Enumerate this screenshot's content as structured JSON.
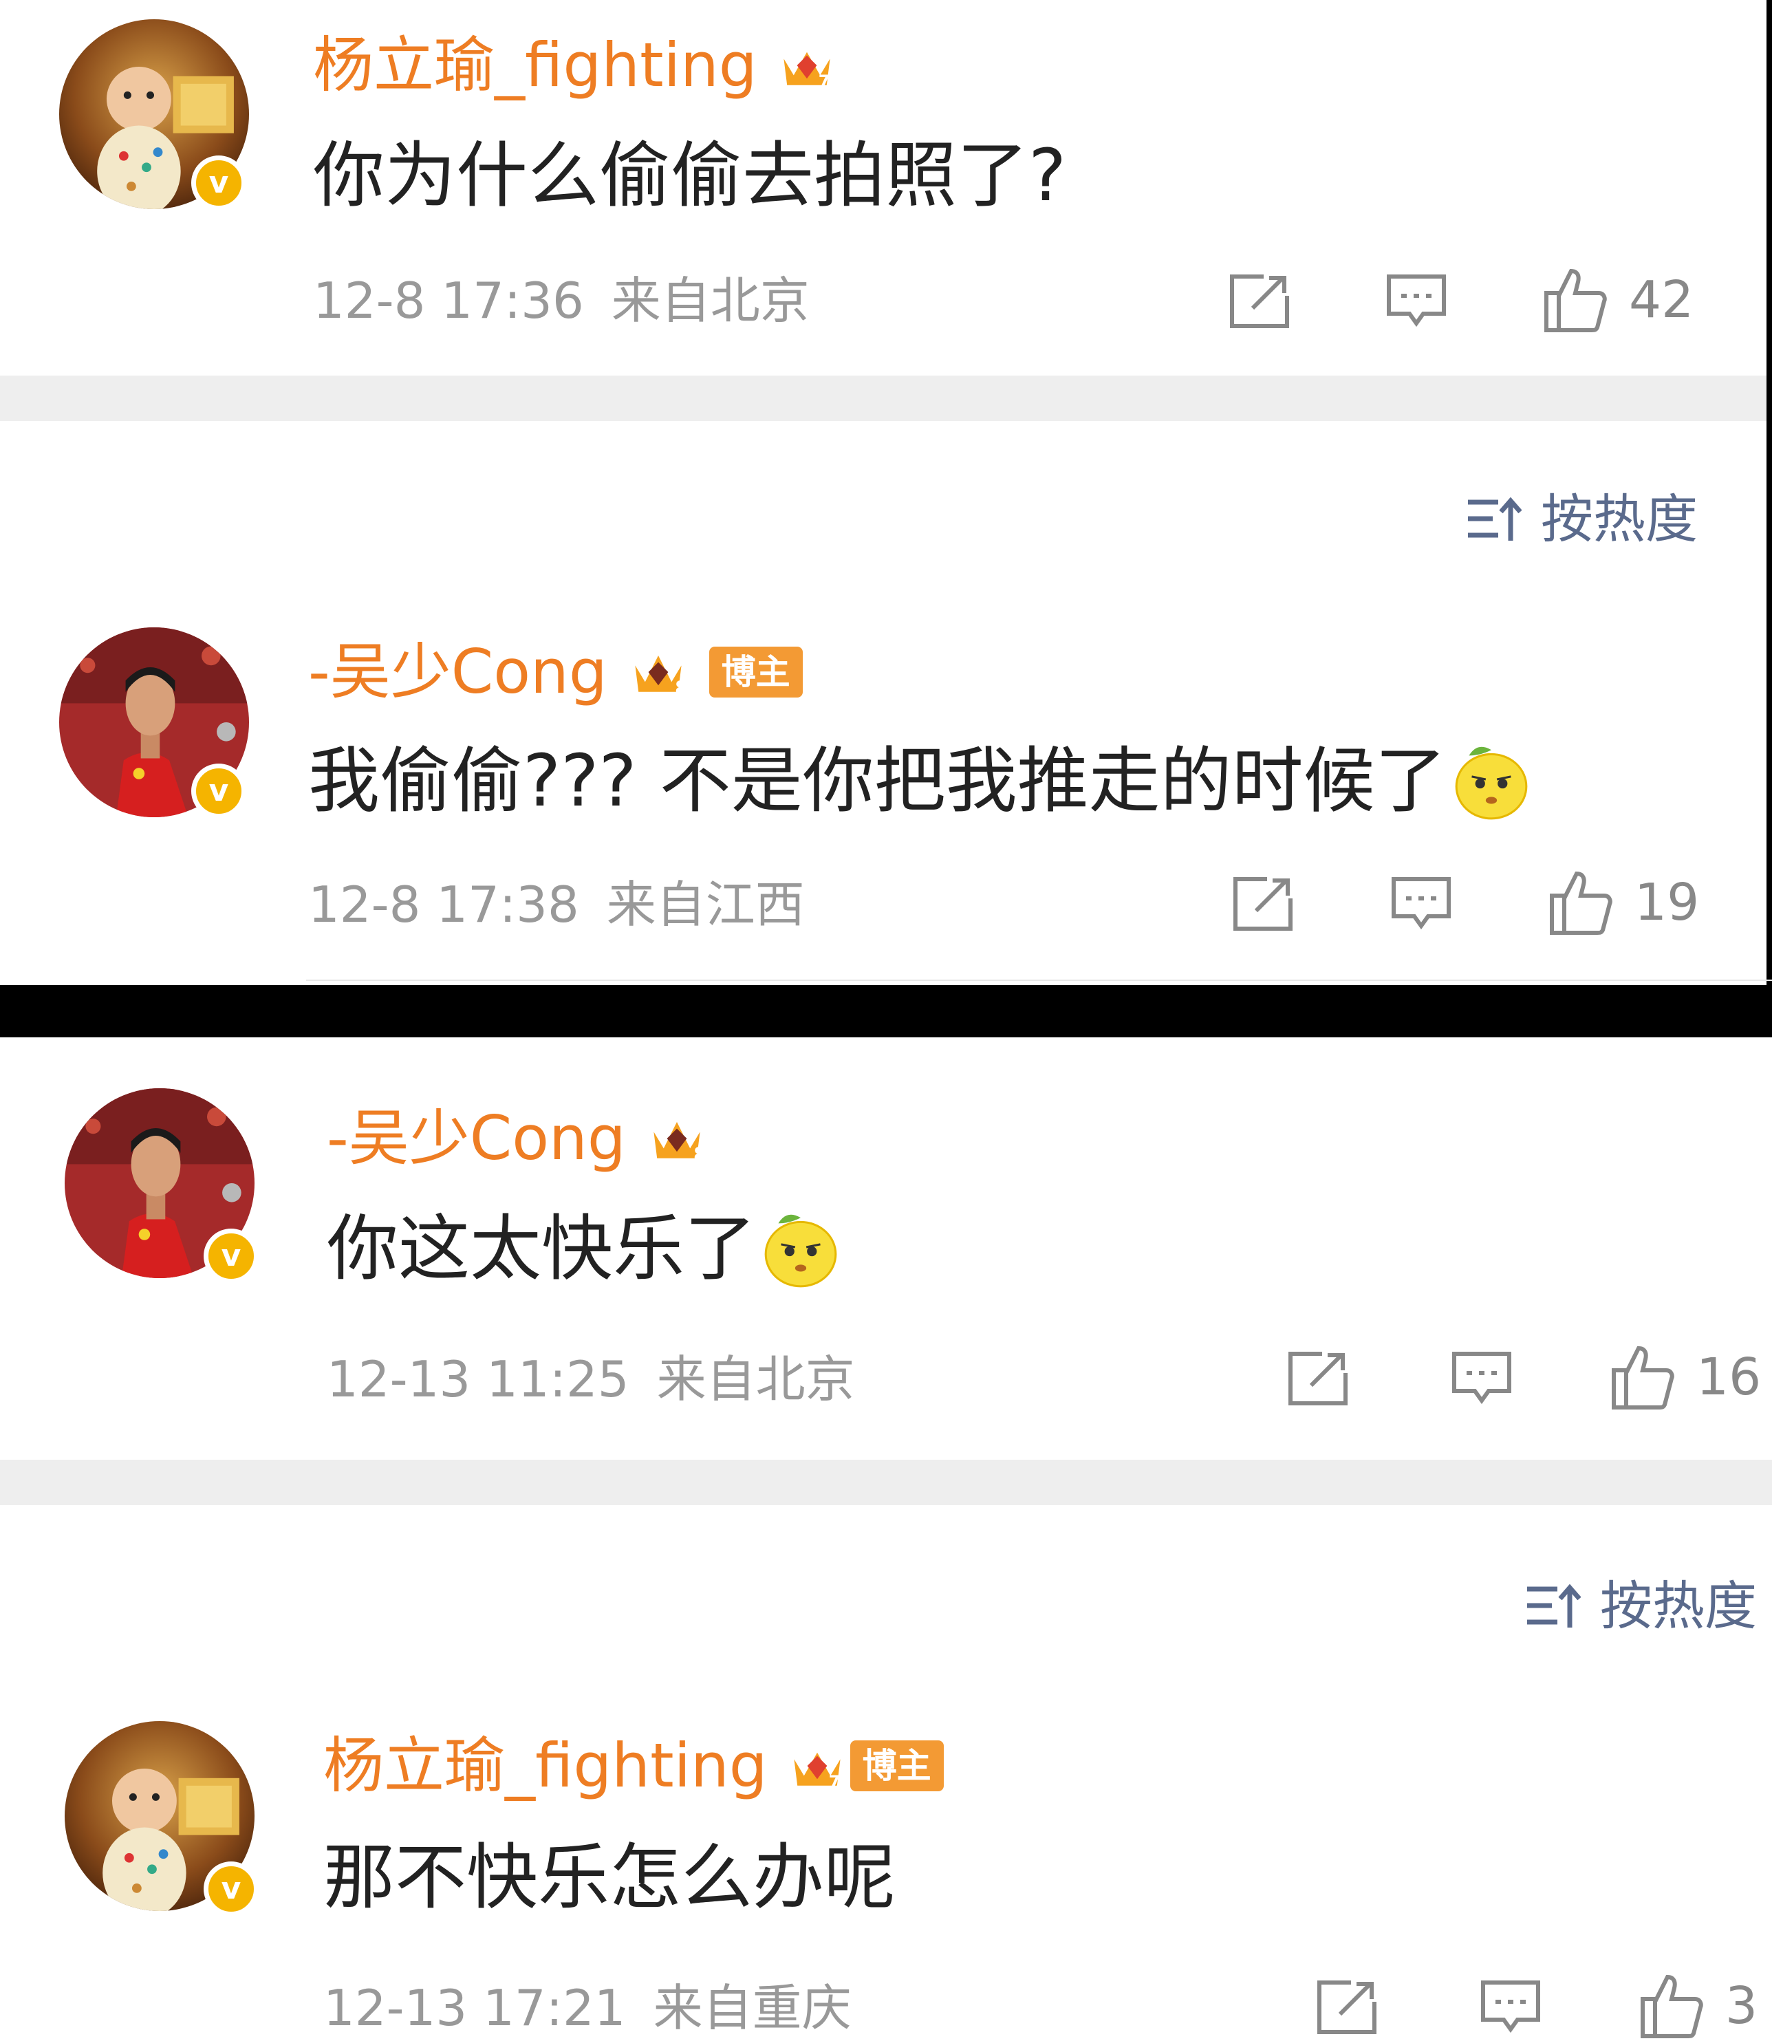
{
  "comments": [
    {
      "username": "杨立瑜_fighting",
      "text": "你为什么偷偷去拍照了?",
      "date": "12-8 17:36",
      "location": "来自北京",
      "likes": "42",
      "badge": "",
      "has_emoji": false
    },
    {
      "username": "-吴少Cong",
      "text": "我偷偷???  不是你把我推走的时候了",
      "date": "12-8 17:38",
      "location": "来自江西",
      "likes": "19",
      "badge": "博主",
      "has_emoji": true
    },
    {
      "username": "-吴少Cong",
      "text": "你这太快乐了",
      "date": "12-13 11:25",
      "location": "来自北京",
      "likes": "16",
      "badge": "",
      "has_emoji": true
    },
    {
      "username": "杨立瑜_fighting",
      "text": "那不快乐怎么办呢",
      "date": "12-13 17:21",
      "location": "来自重庆",
      "likes": "3",
      "badge": "博主",
      "has_emoji": false
    }
  ],
  "sort_label": "按热度",
  "colors": {
    "username": "#ee7d23",
    "verified_badge": "#f5b400",
    "sort_text": "#5a6a8c",
    "meta_text": "#999999",
    "separator": "#eeeeee"
  },
  "icons": {
    "repost": "repost-icon",
    "comment": "comment-icon",
    "like": "like-icon",
    "sort": "sort-icon",
    "crown": "vip-crown-icon",
    "emoji": "sad-lemon-emoji-icon",
    "verified": "verified-v-icon"
  }
}
